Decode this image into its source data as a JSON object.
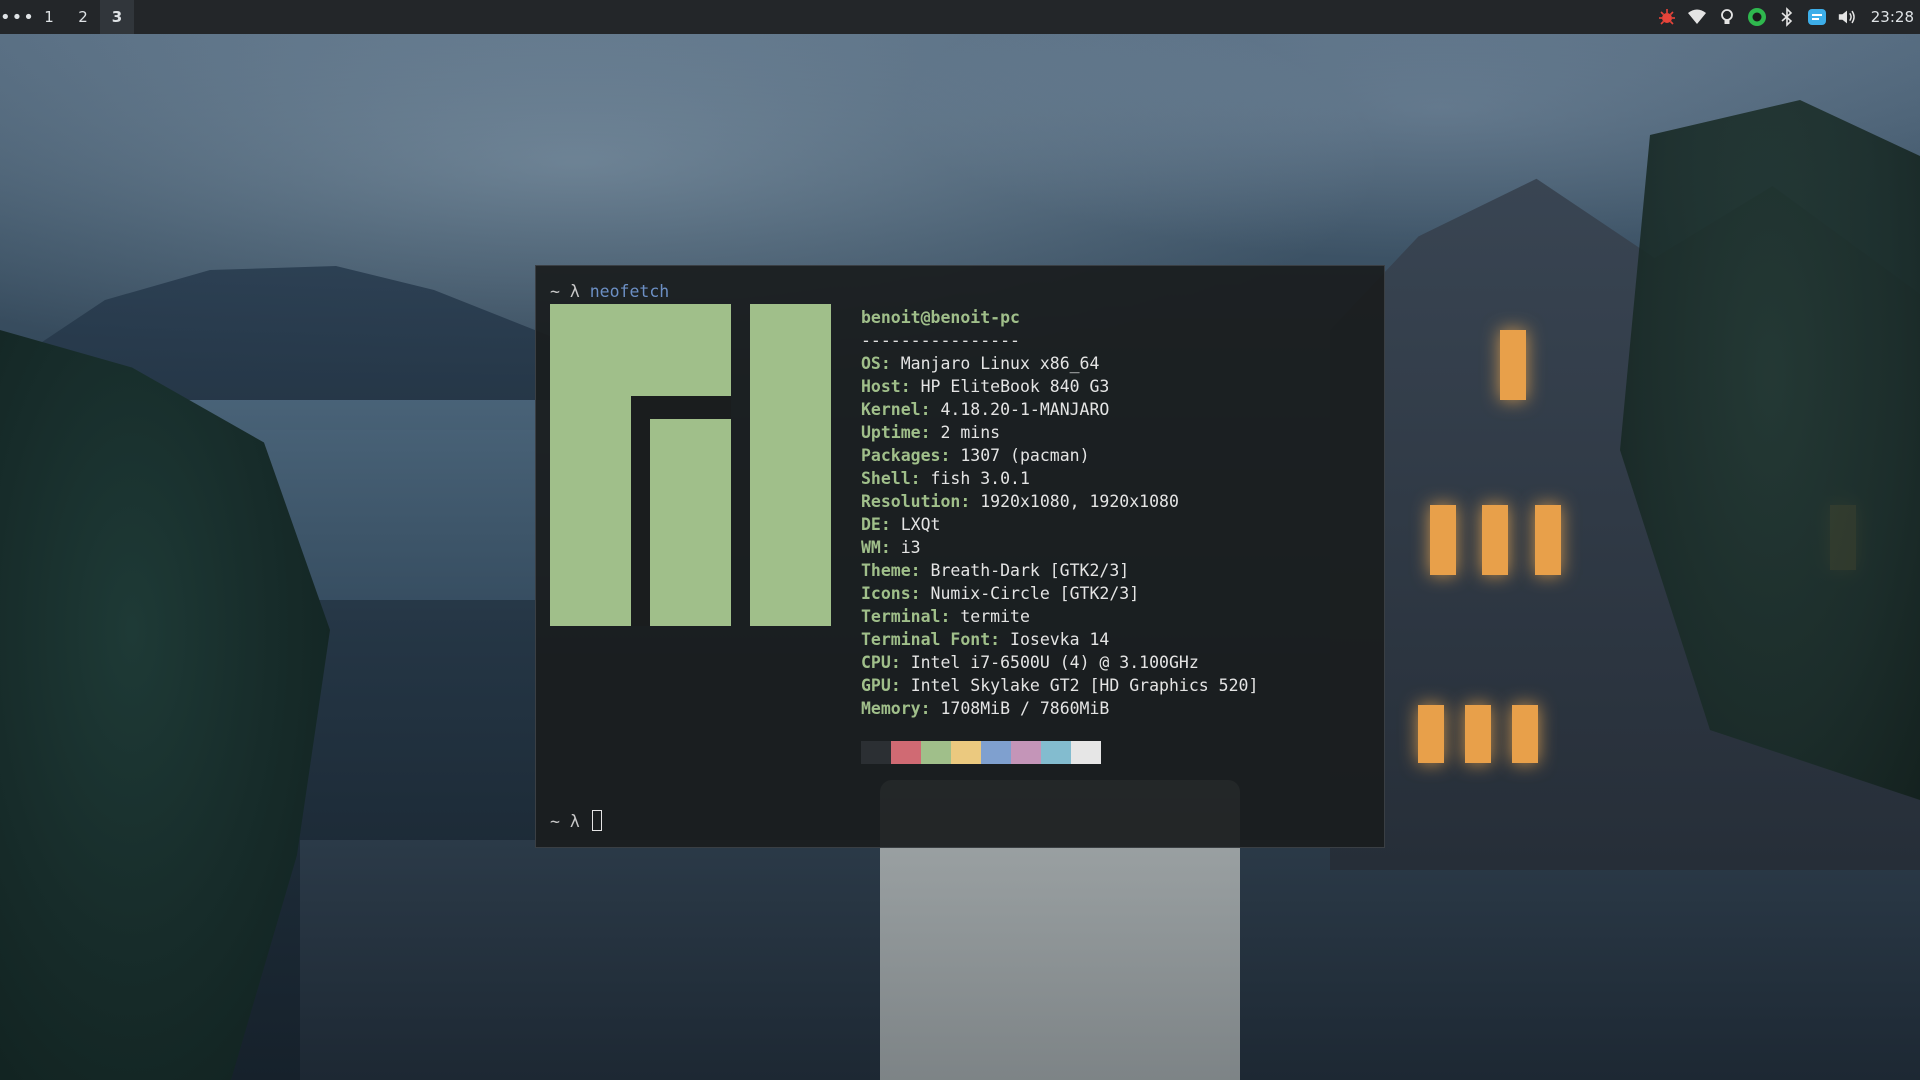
{
  "topbar": {
    "menu_icon": "ellipsis-icon",
    "workspaces": [
      {
        "label": "1",
        "active": false
      },
      {
        "label": "2",
        "active": false
      },
      {
        "label": "3",
        "active": true
      }
    ],
    "tray": [
      {
        "name": "bug-icon",
        "color": "#e8443a"
      },
      {
        "name": "wifi-icon",
        "color": "#e4e4e4"
      },
      {
        "name": "lightbulb-icon",
        "color": "#e4e4e4"
      },
      {
        "name": "circle-status-icon",
        "color": "#2fb84e"
      },
      {
        "name": "bluetooth-icon",
        "color": "#e4e4e4"
      },
      {
        "name": "chat-icon",
        "color": "#3daee9"
      },
      {
        "name": "volume-icon",
        "color": "#e4e4e4"
      }
    ],
    "clock": "23:28"
  },
  "terminal": {
    "prompt_symbol": "~ λ",
    "command": "neofetch",
    "userhost": "benoit@benoit-pc",
    "separator": "----------------",
    "info": [
      {
        "key": "OS",
        "value": "Manjaro Linux x86_64"
      },
      {
        "key": "Host",
        "value": "HP EliteBook 840 G3"
      },
      {
        "key": "Kernel",
        "value": "4.18.20-1-MANJARO"
      },
      {
        "key": "Uptime",
        "value": "2 mins"
      },
      {
        "key": "Packages",
        "value": "1307 (pacman)"
      },
      {
        "key": "Shell",
        "value": "fish 3.0.1"
      },
      {
        "key": "Resolution",
        "value": "1920x1080, 1920x1080"
      },
      {
        "key": "DE",
        "value": "LXQt"
      },
      {
        "key": "WM",
        "value": "i3"
      },
      {
        "key": "Theme",
        "value": "Breath-Dark [GTK2/3]"
      },
      {
        "key": "Icons",
        "value": "Numix-Circle [GTK2/3]"
      },
      {
        "key": "Terminal",
        "value": "termite"
      },
      {
        "key": "Terminal Font",
        "value": "Iosevka 14"
      },
      {
        "key": "CPU",
        "value": "Intel i7-6500U (4) @ 3.100GHz"
      },
      {
        "key": "GPU",
        "value": "Intel Skylake GT2 [HD Graphics 520]"
      },
      {
        "key": "Memory",
        "value": "1708MiB / 7860MiB"
      }
    ],
    "palette": [
      "#2b2f33",
      "#d06a73",
      "#a0bf8a",
      "#ebc97f",
      "#7fa0cf",
      "#c495b8",
      "#83bccf",
      "#e6e6e6"
    ],
    "logo_color": "#a0bf8a"
  }
}
